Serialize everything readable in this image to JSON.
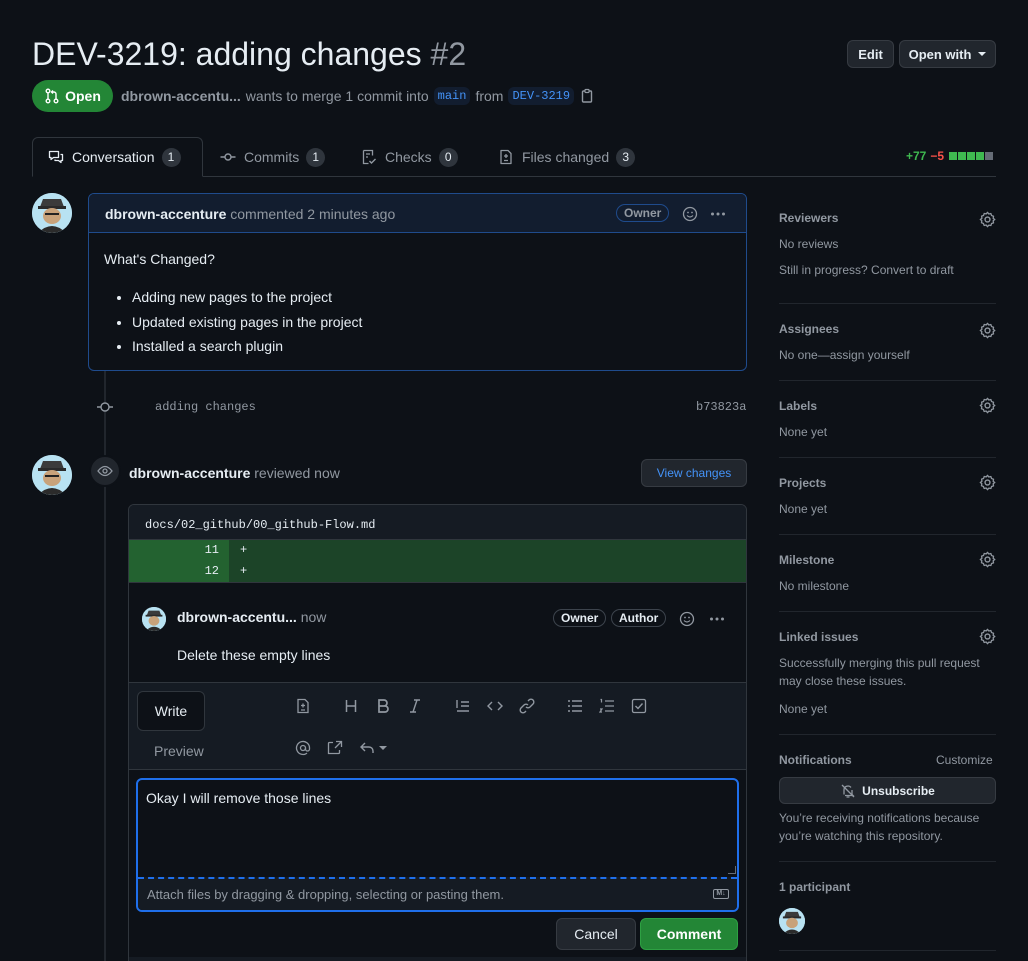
{
  "header": {
    "title": "DEV-3219: adding changes",
    "number": "#2",
    "edit_label": "Edit",
    "open_with_label": "Open with",
    "state_label": "Open",
    "author": "dbrown-accentu...",
    "merge_text": "wants to merge 1 commit into",
    "base_branch": "main",
    "from_text": "from",
    "head_branch": "DEV-3219"
  },
  "tabs": [
    {
      "label": "Conversation",
      "count": "1"
    },
    {
      "label": "Commits",
      "count": "1"
    },
    {
      "label": "Checks",
      "count": "0"
    },
    {
      "label": "Files changed",
      "count": "3"
    }
  ],
  "diffstat": {
    "additions": "+77",
    "deletions": "−5"
  },
  "comment": {
    "author": "dbrown-accenture",
    "action": "commented",
    "time": "2 minutes ago",
    "badge": "Owner",
    "heading": "What's Changed?",
    "items": [
      "Adding new pages to the project",
      "Updated existing pages in the project",
      "Installed a search plugin"
    ]
  },
  "commit": {
    "message": "adding changes",
    "sha": "b73823a"
  },
  "review": {
    "author": "dbrown-accenture",
    "action": "reviewed now",
    "view_changes_label": "View changes",
    "file_path": "docs/02_github/00_github-Flow.md",
    "diff_lines": [
      {
        "num": "11",
        "text": "+"
      },
      {
        "num": "12",
        "text": "+"
      }
    ],
    "thread_comment": {
      "author": "dbrown-accentu...",
      "time": "now",
      "badges": [
        "Owner",
        "Author"
      ],
      "body": "Delete these empty lines"
    },
    "reply": {
      "write_tab": "Write",
      "preview_tab": "Preview",
      "value": "Okay I will remove those lines",
      "attach_hint": "Attach files by dragging & dropping, selecting or pasting them.",
      "cancel_label": "Cancel",
      "comment_label": "Comment"
    }
  },
  "sidebar": {
    "reviewers": {
      "title": "Reviewers",
      "lines": [
        "No reviews",
        "Still in progress? Convert to draft"
      ]
    },
    "assignees": {
      "title": "Assignees",
      "text": "No one—assign yourself"
    },
    "labels": {
      "title": "Labels",
      "text": "None yet"
    },
    "projects": {
      "title": "Projects",
      "text": "None yet"
    },
    "milestone": {
      "title": "Milestone",
      "text": "No milestone"
    },
    "linked_issues": {
      "title": "Linked issues",
      "line1": "Successfully merging this pull request",
      "line2": "may close these issues.",
      "text": "None yet"
    },
    "notifications": {
      "title": "Notifications",
      "customize": "Customize",
      "unsubscribe_label": "Unsubscribe",
      "line1": "You’re receiving notifications because",
      "line2": "you’re watching this repository."
    },
    "participants": {
      "title": "1 participant"
    }
  },
  "colors": {
    "accent": "#4493f8",
    "open_green": "#238636",
    "addition": "#3fb950",
    "deletion": "#f85149",
    "diff_add_bg": "#1c4428"
  }
}
